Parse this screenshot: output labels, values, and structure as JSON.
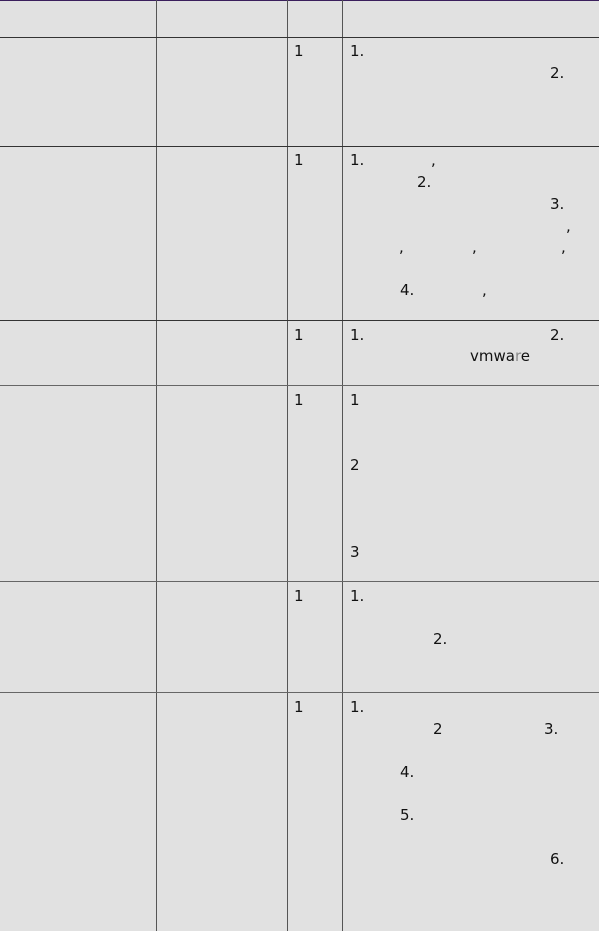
{
  "table": {
    "rows": [
      {
        "qty": "1",
        "items": [
          {
            "text": "1."
          },
          {
            "text": "2."
          }
        ]
      },
      {
        "qty": "1",
        "items": [
          {
            "text": "1."
          },
          {
            "text": ","
          },
          {
            "text": "2."
          },
          {
            "text": "3."
          },
          {
            "text": ","
          },
          {
            "text": ","
          },
          {
            "text": ","
          },
          {
            "text": ","
          },
          {
            "text": "4."
          },
          {
            "text": ","
          }
        ]
      },
      {
        "qty": "1",
        "items": [
          {
            "text": "1."
          },
          {
            "text": "2."
          }
        ],
        "vmware": {
          "a": "vmwa",
          "b": "r",
          "c": "e"
        }
      },
      {
        "qty": "1",
        "items": [
          {
            "text": "1"
          },
          {
            "text": "2"
          },
          {
            "text": "3"
          }
        ]
      },
      {
        "qty": "1",
        "items": [
          {
            "text": "1."
          },
          {
            "text": "2."
          }
        ]
      },
      {
        "qty": "1",
        "items": [
          {
            "text": "1."
          },
          {
            "text": "2"
          },
          {
            "text": "3."
          },
          {
            "text": "4."
          },
          {
            "text": "5."
          },
          {
            "text": "6."
          }
        ]
      }
    ]
  }
}
